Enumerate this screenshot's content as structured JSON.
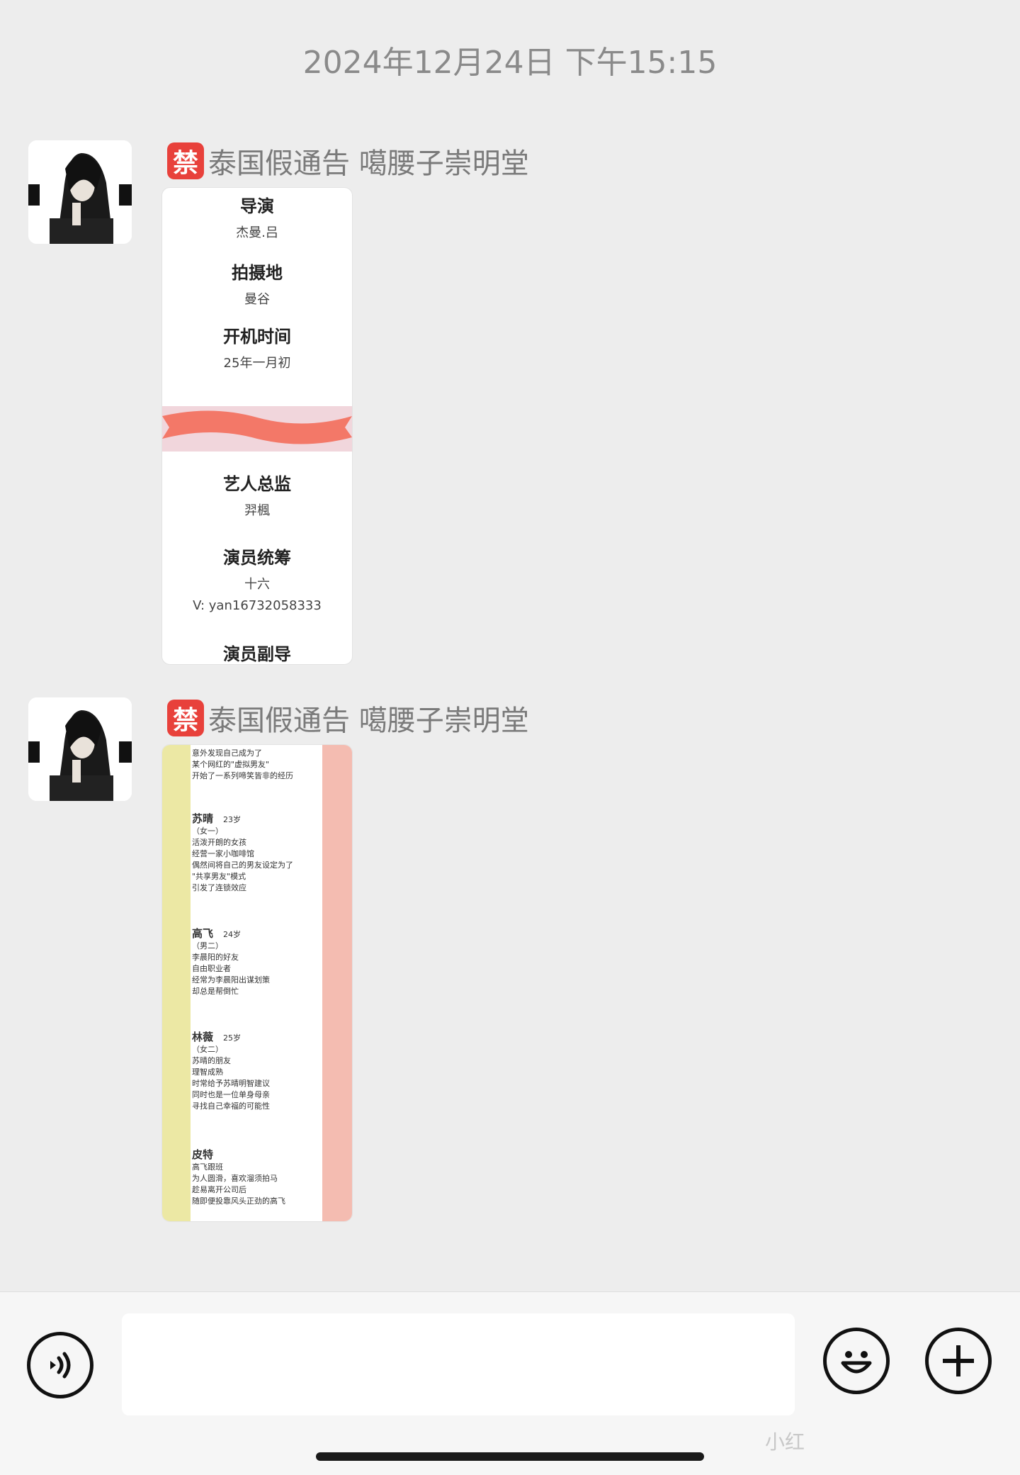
{
  "timestamp": "2024年12月24日 下午15:15",
  "messages": [
    {
      "sender_badge": "禁",
      "sender_name": "泰国假通告 噶腰子崇明堂",
      "card1": {
        "director_h": "导演",
        "director_v": "杰曼.吕",
        "location_h": "拍摄地",
        "location_v": "曼谷",
        "start_h": "开机时间",
        "start_v": "25年一月初",
        "artist_h": "艺人总监",
        "artist_v": "羿楓",
        "coord_h": "演员统筹",
        "coord_v": "十六",
        "coord_contact": "V:  yan16732058333",
        "assist_h": "演员副导"
      }
    },
    {
      "sender_badge": "禁",
      "sender_name": "泰国假通告 噶腰子崇明堂",
      "card2": {
        "intro": [
          "意外发现自己成为了",
          "某个网红的\"虚拟男友\"",
          "开始了一系列啼笑皆非的经历"
        ],
        "c1_name": "苏晴",
        "c1_age": "23岁",
        "c1_lines": [
          "（女一）",
          "活泼开朗的女孩",
          "经营一家小咖啡馆",
          "偶然间将自己的男友设定为了",
          "\"共享男友\"模式",
          "引发了连锁效应"
        ],
        "c2_name": "高飞",
        "c2_age": "24岁",
        "c2_lines": [
          "（男二）",
          "李晨阳的好友",
          "自由职业者",
          "经常为李晨阳出谋划策",
          "却总是帮倒忙"
        ],
        "c3_name": "林薇",
        "c3_age": "25岁",
        "c3_lines": [
          "（女二）",
          "苏晴的朋友",
          "理智成熟",
          "时常给予苏晴明智建议",
          "同时也是一位单身母亲",
          "寻找自己幸福的可能性"
        ],
        "c4_name": "皮特",
        "c4_lines": [
          "高飞跟班",
          "为人圆滑，喜欢溜须拍马",
          "趁易离开公司后",
          "随即便投靠风头正劲的高飞"
        ]
      }
    }
  ],
  "watermark": "小红",
  "icons": {
    "voice": "voice-icon",
    "emoji": "emoji-icon",
    "plus": "plus-icon"
  }
}
